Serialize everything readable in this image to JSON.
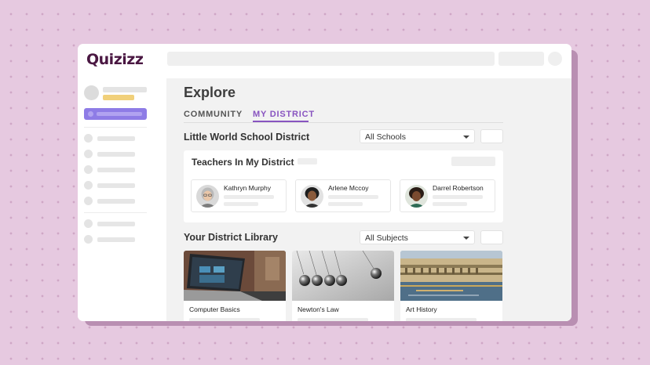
{
  "app": {
    "logo_text": "Quizizz",
    "brand_color": "#4a1742",
    "accent_color": "#8854c0"
  },
  "page": {
    "title": "Explore"
  },
  "tabs": [
    {
      "label": "COMMUNITY",
      "active": false
    },
    {
      "label": "MY DISTRICT",
      "active": true
    }
  ],
  "district": {
    "name": "Little World School District",
    "filter_selected": "All Schools"
  },
  "teachers": {
    "title": "Teachers In My District",
    "items": [
      {
        "name": "Kathryn Murphy",
        "icon": "avatar-kathryn"
      },
      {
        "name": "Arlene Mccoy",
        "icon": "avatar-arlene"
      },
      {
        "name": "Darrel Robertson",
        "icon": "avatar-darrel"
      }
    ]
  },
  "library": {
    "title": "Your District Library",
    "filter_selected": "All Subjects",
    "items": [
      {
        "title": "Computer Basics",
        "icon": "laptop-image"
      },
      {
        "title": "Newton's Law",
        "icon": "newtons-cradle-image"
      },
      {
        "title": "Art History",
        "icon": "painting-image"
      }
    ]
  }
}
